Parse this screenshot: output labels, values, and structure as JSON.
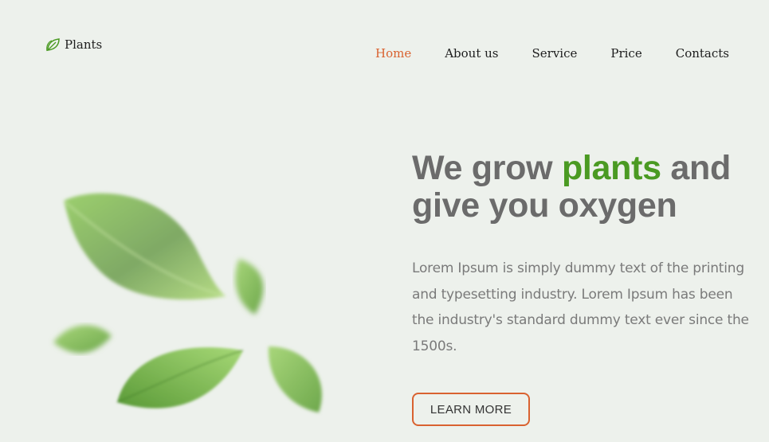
{
  "brand": {
    "name": "Plants",
    "icon": "leaf-icon"
  },
  "nav": {
    "items": [
      {
        "label": "Home",
        "active": true
      },
      {
        "label": "About us",
        "active": false
      },
      {
        "label": "Service",
        "active": false
      },
      {
        "label": "Price",
        "active": false
      },
      {
        "label": "Contacts",
        "active": false
      }
    ]
  },
  "hero": {
    "title_part1": "We grow ",
    "title_accent": "plants",
    "title_part2": " and give you oxygen",
    "description": "Lorem Ipsum is simply dummy text of the printing and typesetting industry. Lorem Ipsum has been the industry's standard dummy text ever since the 1500s.",
    "button_label": "LEARN MORE"
  },
  "colors": {
    "background": "#edf1ec",
    "accent_orange": "#d96230",
    "accent_green": "#4a9a22",
    "title_gray": "#6b6b6b"
  }
}
